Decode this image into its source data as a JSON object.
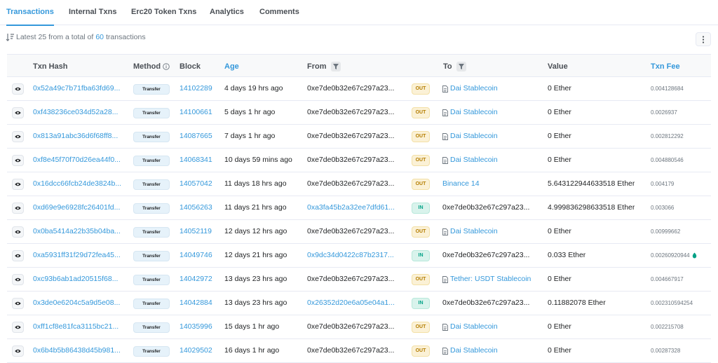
{
  "tabs": [
    {
      "label": "Transactions",
      "active": true
    },
    {
      "label": "Internal Txns",
      "active": false
    },
    {
      "label": "Erc20 Token Txns",
      "active": false
    },
    {
      "label": "Analytics",
      "active": false
    },
    {
      "label": "Comments",
      "active": false
    }
  ],
  "summary": {
    "prefix": "Latest 25 from a total of",
    "count": "60",
    "suffix": "transactions"
  },
  "columns": {
    "hash": "Txn Hash",
    "method": "Method",
    "block": "Block",
    "age": "Age",
    "from": "From",
    "to": "To",
    "value": "Value",
    "fee": "Txn Fee"
  },
  "rows": [
    {
      "hash": "0x52a49c7b71fba63fd69...",
      "method": "Transfer",
      "block": "14102289",
      "age": "4 days 19 hrs ago",
      "from": "0xe7de0b32e67c297a23...",
      "from_link": false,
      "direction": "OUT",
      "to": "Dai Stablecoin",
      "to_link": true,
      "to_contract": true,
      "value": "0 Ether",
      "fee": "0.004128684",
      "gas_icon": false
    },
    {
      "hash": "0xf438236ce034d52a28...",
      "method": "Transfer",
      "block": "14100661",
      "age": "5 days 1 hr ago",
      "from": "0xe7de0b32e67c297a23...",
      "from_link": false,
      "direction": "OUT",
      "to": "Dai Stablecoin",
      "to_link": true,
      "to_contract": true,
      "value": "0 Ether",
      "fee": "0.0026937",
      "gas_icon": false
    },
    {
      "hash": "0x813a91abc36d6f68ff8...",
      "method": "Transfer",
      "block": "14087665",
      "age": "7 days 1 hr ago",
      "from": "0xe7de0b32e67c297a23...",
      "from_link": false,
      "direction": "OUT",
      "to": "Dai Stablecoin",
      "to_link": true,
      "to_contract": true,
      "value": "0 Ether",
      "fee": "0.002812292",
      "gas_icon": false
    },
    {
      "hash": "0xf8e45f70f70d26ea44f0...",
      "method": "Transfer",
      "block": "14068341",
      "age": "10 days 59 mins ago",
      "from": "0xe7de0b32e67c297a23...",
      "from_link": false,
      "direction": "OUT",
      "to": "Dai Stablecoin",
      "to_link": true,
      "to_contract": true,
      "value": "0 Ether",
      "fee": "0.004880546",
      "gas_icon": false
    },
    {
      "hash": "0x16dcc66fcb24de3824b...",
      "method": "Transfer",
      "block": "14057042",
      "age": "11 days 18 hrs ago",
      "from": "0xe7de0b32e67c297a23...",
      "from_link": false,
      "direction": "OUT",
      "to": "Binance 14",
      "to_link": true,
      "to_contract": false,
      "value": "5.643122944633518 Ether",
      "fee": "0.004179",
      "gas_icon": false
    },
    {
      "hash": "0xd69e9e6928fc26401fd...",
      "method": "Transfer",
      "block": "14056263",
      "age": "11 days 21 hrs ago",
      "from": "0xa3fa45b2a32ee7dfd61...",
      "from_link": true,
      "direction": "IN",
      "to": "0xe7de0b32e67c297a23...",
      "to_link": false,
      "to_contract": false,
      "value": "4.999836298633518 Ether",
      "fee": "0.003066",
      "gas_icon": false
    },
    {
      "hash": "0x0ba5414a22b35b04ba...",
      "method": "Transfer",
      "block": "14052119",
      "age": "12 days 12 hrs ago",
      "from": "0xe7de0b32e67c297a23...",
      "from_link": false,
      "direction": "OUT",
      "to": "Dai Stablecoin",
      "to_link": true,
      "to_contract": true,
      "value": "0 Ether",
      "fee": "0.00999662",
      "gas_icon": false
    },
    {
      "hash": "0xa5931ff31f29d72fea45...",
      "method": "Transfer",
      "block": "14049746",
      "age": "12 days 21 hrs ago",
      "from": "0x9dc34d0422c87b2317...",
      "from_link": true,
      "direction": "IN",
      "to": "0xe7de0b32e67c297a23...",
      "to_link": false,
      "to_contract": false,
      "value": "0.033 Ether",
      "fee": "0.00260920944",
      "gas_icon": true
    },
    {
      "hash": "0xc93b6ab1ad20515f68...",
      "method": "Transfer",
      "block": "14042972",
      "age": "13 days 23 hrs ago",
      "from": "0xe7de0b32e67c297a23...",
      "from_link": false,
      "direction": "OUT",
      "to": "Tether: USDT Stablecoin",
      "to_link": true,
      "to_contract": true,
      "value": "0 Ether",
      "fee": "0.004667917",
      "gas_icon": false
    },
    {
      "hash": "0x3de0e6204c5a9d5e08...",
      "method": "Transfer",
      "block": "14042884",
      "age": "13 days 23 hrs ago",
      "from": "0x26352d20e6a05e04a1...",
      "from_link": true,
      "direction": "IN",
      "to": "0xe7de0b32e67c297a23...",
      "to_link": false,
      "to_contract": false,
      "value": "0.11882078 Ether",
      "fee": "0.00231059425​4",
      "gas_icon": false
    },
    {
      "hash": "0xff1cf8e81fca3115bc21...",
      "method": "Transfer",
      "block": "14035996",
      "age": "15 days 1 hr ago",
      "from": "0xe7de0b32e67c297a23...",
      "from_link": false,
      "direction": "OUT",
      "to": "Dai Stablecoin",
      "to_link": true,
      "to_contract": true,
      "value": "0 Ether",
      "fee": "0.002215708",
      "gas_icon": false
    },
    {
      "hash": "0x6b4b5b86438d45b981...",
      "method": "Transfer",
      "block": "14029502",
      "age": "16 days 1 hr ago",
      "from": "0xe7de0b32e67c297a23...",
      "from_link": false,
      "direction": "OUT",
      "to": "Dai Stablecoin",
      "to_link": true,
      "to_contract": true,
      "value": "0 Ether",
      "fee": "0.00287328",
      "gas_icon": false
    }
  ],
  "colors": {
    "accent": "#3498db",
    "out_badge": "#fbf1d6",
    "in_badge": "#d9f3ec"
  }
}
